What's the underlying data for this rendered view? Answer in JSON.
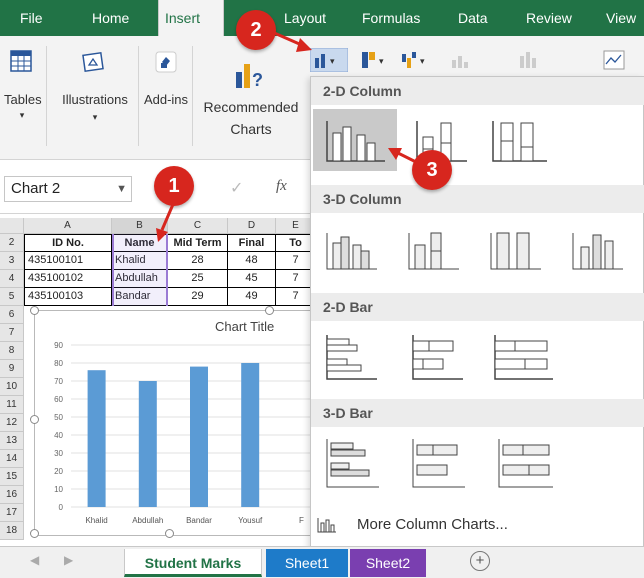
{
  "ribbon": {
    "tabs": [
      "File",
      "Home",
      "Insert",
      "Page Layout",
      "Formulas",
      "Data",
      "Review",
      "View"
    ],
    "tab_visible_labels": [
      "File",
      "Home",
      "Insert",
      "Layout",
      "Formulas",
      "Data",
      "Review",
      "View"
    ],
    "active_tab": "Insert",
    "groups": {
      "tables": "Tables",
      "illustrations": "Illustrations",
      "addins": "Add-ins",
      "recommended_charts": "Recommended Charts"
    }
  },
  "formula_bar": {
    "name_box": "Chart 2",
    "fx": "fx",
    "check": "✓"
  },
  "sheet": {
    "columns": [
      "A",
      "B",
      "C",
      "D",
      "E"
    ],
    "rows": [
      "2",
      "3",
      "4",
      "5",
      "6",
      "7",
      "8",
      "9",
      "10",
      "11",
      "12",
      "13",
      "14",
      "15",
      "16",
      "17",
      "18"
    ],
    "headers": [
      "ID No.",
      "Name",
      "Mid Term",
      "Final",
      "To"
    ],
    "data": [
      [
        "435100101",
        "Khalid",
        "28",
        "48",
        "7"
      ],
      [
        "435100102",
        "Abdullah",
        "25",
        "45",
        "7"
      ],
      [
        "435100103",
        "Bandar",
        "29",
        "49",
        "7"
      ]
    ]
  },
  "chart_data": {
    "type": "bar",
    "title": "Chart Title",
    "categories": [
      "Khalid",
      "Abdullah",
      "Bandar",
      "Yousuf",
      "F"
    ],
    "values": [
      76,
      70,
      78,
      80
    ],
    "ylim": [
      0,
      90
    ],
    "yticks": [
      0,
      10,
      20,
      30,
      40,
      50,
      60,
      70,
      80,
      90
    ],
    "bar_color": "#5b9bd5",
    "grid": true
  },
  "gallery": {
    "sections": [
      "2-D Column",
      "3-D Column",
      "2-D Bar",
      "3-D Bar"
    ],
    "more": "More Column Charts..."
  },
  "sheet_tabs": [
    "Student Marks",
    "Sheet1",
    "Sheet2"
  ],
  "callouts": [
    "1",
    "2",
    "3"
  ],
  "colors": {
    "excel_green": "#217346",
    "callout_red": "#d7261e",
    "sheet1_tab": "#1e7bc9",
    "sheet2_tab": "#7a3fb0"
  }
}
